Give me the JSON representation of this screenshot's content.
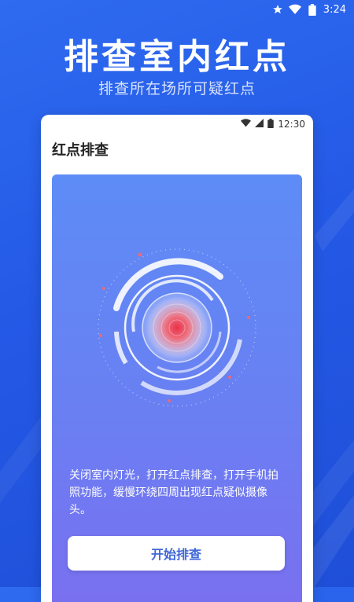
{
  "status_bar": {
    "time": "3:24",
    "icons": [
      "star-icon",
      "wifi-icon",
      "battery-icon"
    ]
  },
  "hero": {
    "title": "排查室内红点",
    "subtitle": "排查所在场所可疑红点"
  },
  "phone": {
    "status_time": "12:30",
    "status_icons": [
      "wifi-icon",
      "signal-icon",
      "battery-icon"
    ],
    "header_title": "红点排查",
    "description": "关闭室内灯光，打开红点排查，打开手机拍照功能，缓慢环绕四周出现红点疑似摄像头。",
    "start_button": "开始排查"
  },
  "colors": {
    "background": "#2459e6",
    "card_top": "#5d8cf6",
    "card_bottom": "#7a6ff0",
    "button_text": "#3f67d8",
    "radar_center": "#e8324a"
  }
}
